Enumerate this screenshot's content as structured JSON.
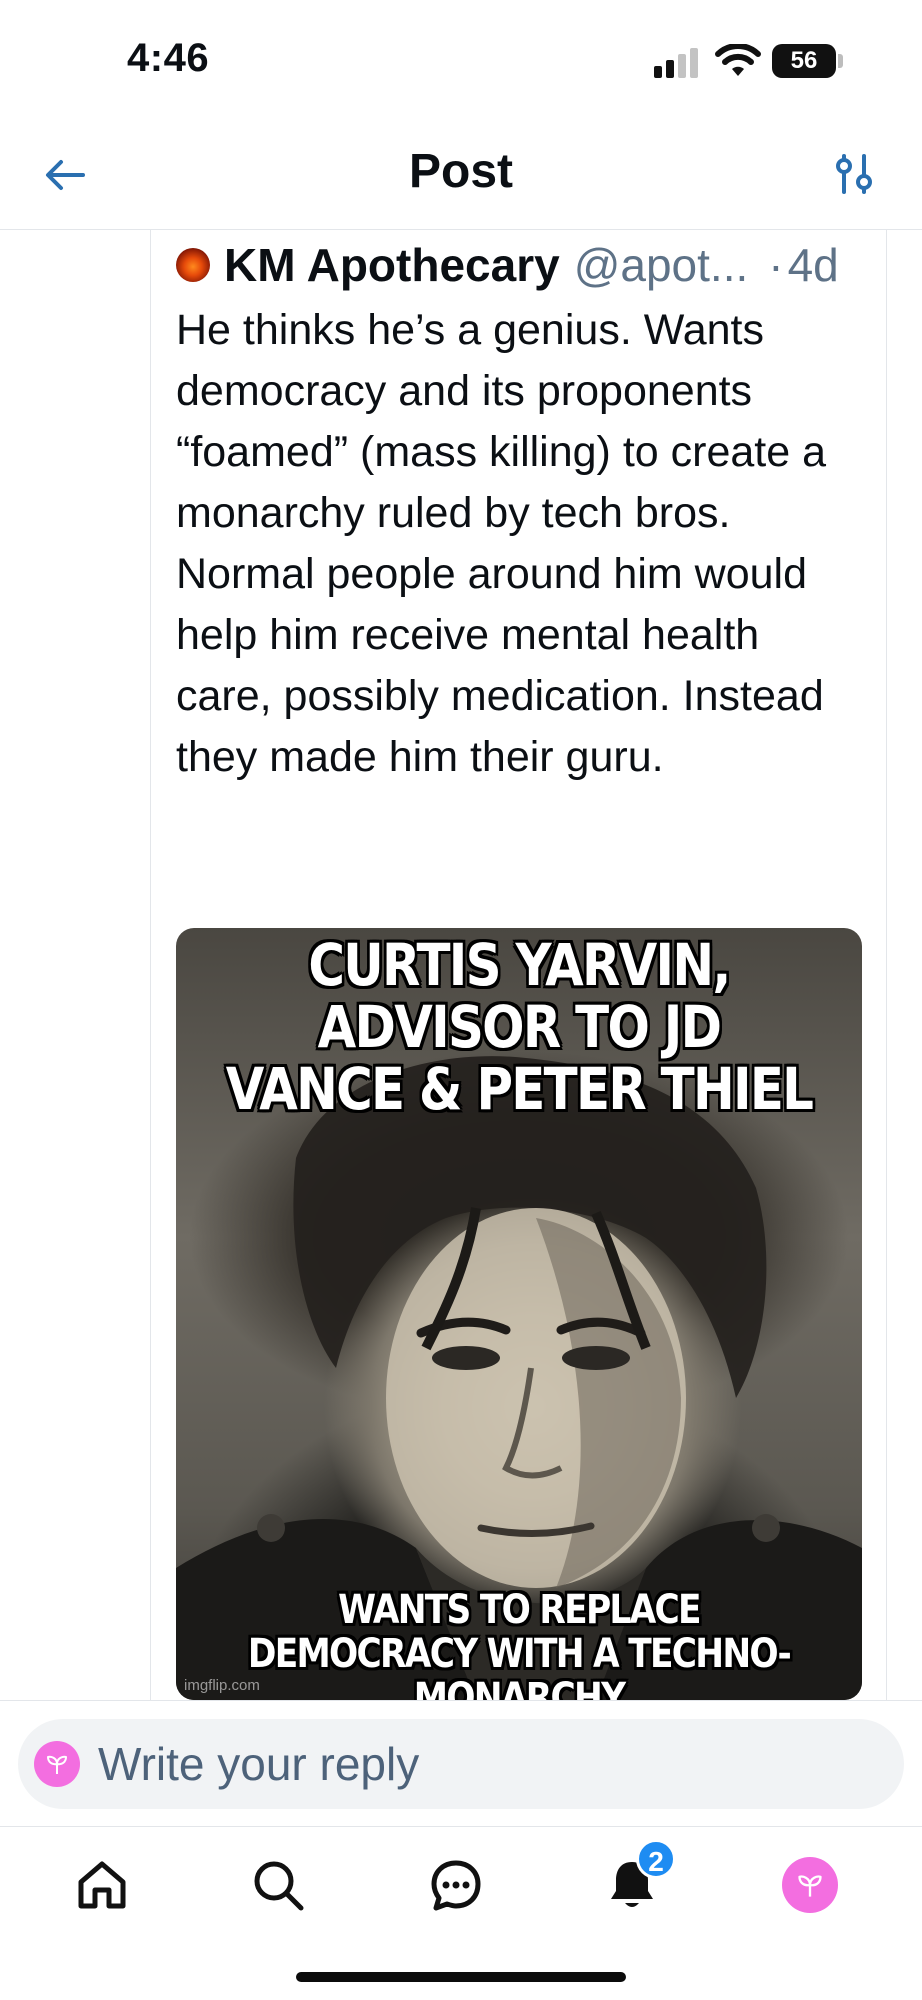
{
  "status_bar": {
    "time": "4:46",
    "battery": "56",
    "icons": [
      "signal-icon",
      "wifi-icon",
      "battery-icon"
    ]
  },
  "header": {
    "title": "Post",
    "back_icon": "arrow-left-icon",
    "filter_icon": "sliders-icon"
  },
  "post": {
    "author_name": "KM Apothecary",
    "author_handle": "@apot...",
    "separator": "·",
    "time": "4d",
    "text": "He thinks he’s a genius. Wants democracy and its proponents “foamed” (mass killing) to create a monarchy ruled by tech bros.\nNormal people around him would help him receive mental health care, possibly medication. Instead they made him their guru.",
    "image": {
      "top_caption": "CURTIS YARVIN, ADVISOR TO JD VANCE & PETER THIEL",
      "bottom_caption": "WANTS TO REPLACE DEMOCRACY WITH A TECHNO-MONARCHY",
      "watermark": "imgflip.com"
    }
  },
  "reply": {
    "placeholder": "Write your reply"
  },
  "tab_bar": {
    "items": [
      {
        "name": "home",
        "icon": "home-icon"
      },
      {
        "name": "search",
        "icon": "search-icon"
      },
      {
        "name": "chat",
        "icon": "chat-icon"
      },
      {
        "name": "notifications",
        "icon": "bell-icon",
        "badge": "2"
      },
      {
        "name": "profile",
        "icon": "avatar"
      }
    ]
  },
  "colors": {
    "accent_blue": "#1e8cf2",
    "handle_gray": "#5e7287",
    "avatar_pink": "#f36ee0",
    "divider": "#e3e6ea"
  }
}
